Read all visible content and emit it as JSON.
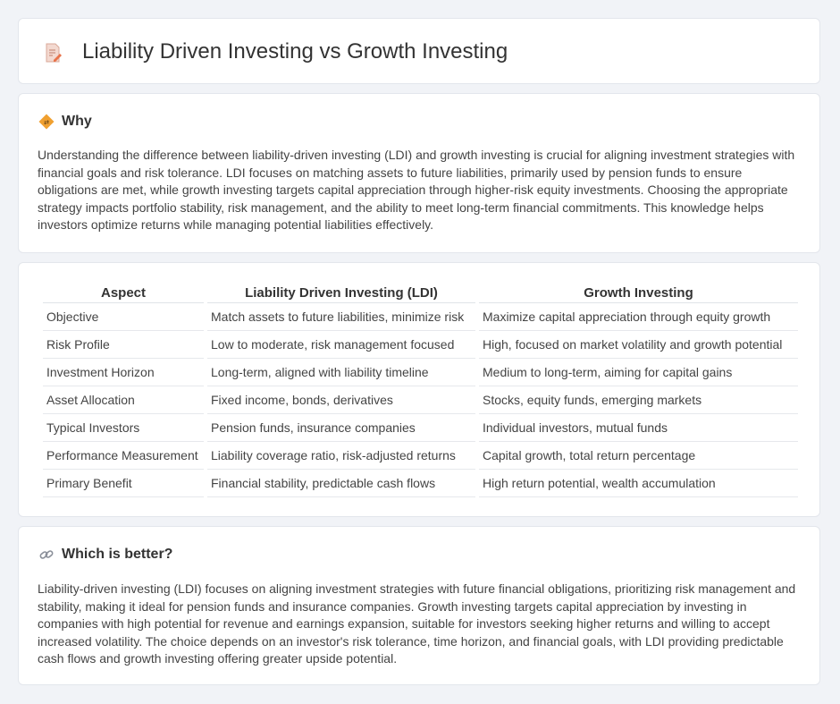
{
  "header": {
    "title": "Liability Driven Investing vs Growth Investing",
    "icon": "document-pencil-icon"
  },
  "why": {
    "heading": "Why",
    "icon": "diamond-sign-icon",
    "text": "Understanding the difference between liability-driven investing (LDI) and growth investing is crucial for aligning investment strategies with financial goals and risk tolerance. LDI focuses on matching assets to future liabilities, primarily used by pension funds to ensure obligations are met, while growth investing targets capital appreciation through higher-risk equity investments. Choosing the appropriate strategy impacts portfolio stability, risk management, and the ability to meet long-term financial commitments. This knowledge helps investors optimize returns while managing potential liabilities effectively."
  },
  "table": {
    "columns": [
      "Aspect",
      "Liability Driven Investing (LDI)",
      "Growth Investing"
    ],
    "rows": [
      [
        "Objective",
        "Match assets to future liabilities, minimize risk",
        "Maximize capital appreciation through equity growth"
      ],
      [
        "Risk Profile",
        "Low to moderate, risk management focused",
        "High, focused on market volatility and growth potential"
      ],
      [
        "Investment Horizon",
        "Long-term, aligned with liability timeline",
        "Medium to long-term, aiming for capital gains"
      ],
      [
        "Asset Allocation",
        "Fixed income, bonds, derivatives",
        "Stocks, equity funds, emerging markets"
      ],
      [
        "Typical Investors",
        "Pension funds, insurance companies",
        "Individual investors, mutual funds"
      ],
      [
        "Performance Measurement",
        "Liability coverage ratio, risk-adjusted returns",
        "Capital growth, total return percentage"
      ],
      [
        "Primary Benefit",
        "Financial stability, predictable cash flows",
        "High return potential, wealth accumulation"
      ]
    ]
  },
  "better": {
    "heading": "Which is better?",
    "icon": "link-icon",
    "text": "Liability-driven investing (LDI) focuses on aligning investment strategies with future financial obligations, prioritizing risk management and stability, making it ideal for pension funds and insurance companies. Growth investing targets capital appreciation by investing in companies with high potential for revenue and earnings expansion, suitable for investors seeking higher returns and willing to accept increased volatility. The choice depends on an investor's risk tolerance, time horizon, and financial goals, with LDI providing predictable cash flows and growth investing offering greater upside potential."
  },
  "colors": {
    "page_bg": "#f1f3f7",
    "card_bg": "#ffffff",
    "icon_accent": "#e8734a",
    "sign_orange": "#f0a030"
  }
}
